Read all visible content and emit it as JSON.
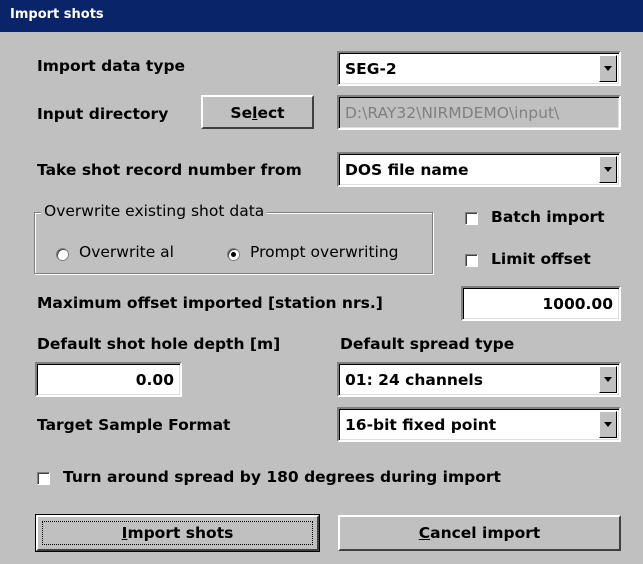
{
  "window": {
    "title": "Import shots"
  },
  "import_data_type": {
    "label": "Import data type",
    "value": "SEG-2"
  },
  "input_directory": {
    "label": "Input directory",
    "select_label_pre": "Se",
    "select_label_ul": "l",
    "select_label_post": "ect",
    "path": "D:\\RAY32\\NIRMDEMO\\input\\"
  },
  "shot_record": {
    "label": "Take shot record number from",
    "value": "DOS file name"
  },
  "overwrite_group": {
    "title": "Overwrite existing shot data",
    "options": [
      {
        "label": "Overwrite al",
        "selected": false
      },
      {
        "label": "Prompt overwriting",
        "selected": true
      }
    ]
  },
  "batch_import": {
    "label": "Batch import",
    "checked": false
  },
  "limit_offset": {
    "label": "Limit offset",
    "checked": false
  },
  "max_offset": {
    "label": "Maximum offset imported [station nrs.]",
    "value": "1000.00"
  },
  "shot_hole_depth": {
    "label": "Default shot hole depth [m]",
    "value": "0.00"
  },
  "spread_type": {
    "label": "Default spread type",
    "value": "01:  24 channels"
  },
  "sample_format": {
    "label": "Target Sample Format",
    "value": "16-bit fixed point"
  },
  "turn_around": {
    "label": "Turn around spread by 180 degrees during import",
    "checked": false
  },
  "buttons": {
    "import_ul": "I",
    "import_rest": "mport shots",
    "cancel_ul": "C",
    "cancel_rest": "ancel import"
  }
}
